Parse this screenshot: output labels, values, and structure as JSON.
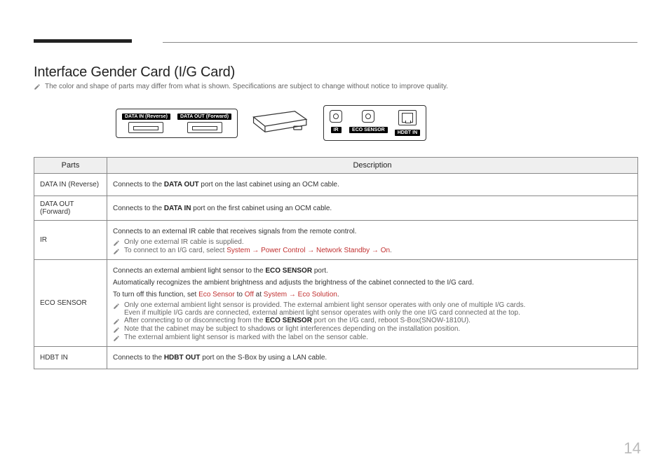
{
  "title": "Interface Gender Card (I/G Card)",
  "top_note": "The color and shape of parts may differ from what is shown. Specifications are subject to change without notice to improve quality.",
  "diagram": {
    "data_in_label": "DATA IN (Reverse)",
    "data_out_label": "DATA OUT (Forward)",
    "ir_label": "IR",
    "eco_label": "ECO SENSOR",
    "hdbt_label": "HDBT IN"
  },
  "table": {
    "header_parts": "Parts",
    "header_desc": "Description",
    "rows": {
      "data_in": {
        "part": "DATA IN (Reverse)",
        "desc_pre": "Connects to the ",
        "desc_bold": "DATA OUT",
        "desc_post": " port on the last cabinet using an OCM cable."
      },
      "data_out": {
        "part": "DATA OUT (Forward)",
        "desc_pre": "Connects to the ",
        "desc_bold": "DATA IN",
        "desc_post": " port on the first cabinet using an OCM cable."
      },
      "ir": {
        "part": "IR",
        "line1": "Connects to an external IR cable that receives signals from the remote control.",
        "note1": "Only one external IR cable is supplied.",
        "note2_pre": "To connect to an I/G card, select ",
        "note2_path": "System → Power Control → Network Standby → On",
        "note2_post": "."
      },
      "eco": {
        "part": "ECO SENSOR",
        "line1_pre": "Connects an external ambient light sensor to the ",
        "line1_bold": "ECO SENSOR",
        "line1_post": " port.",
        "line2": "Automatically recognizes the ambient brightness and adjusts the brightness of the cabinet connected to the I/G card.",
        "line3_pre": "To turn off this function, set ",
        "line3_p1": "Eco Sensor",
        "line3_mid1": " to ",
        "line3_p2": "Off",
        "line3_mid2": " at ",
        "line3_p3": "System → Eco Solution",
        "line3_post": ".",
        "note1a": "Only one external ambient light sensor is provided. The external ambient light sensor operates with only one of multiple I/G cards.",
        "note1b": "Even if multiple I/G cards are connected, external ambient light sensor operates with only the one I/G card connected at the top.",
        "note2_pre": "After connecting to or disconnecting from the ",
        "note2_bold": "ECO SENSOR",
        "note2_post": " port on the I/G card, reboot S-Box(SNOW-1810U).",
        "note3": "Note that the cabinet may be subject to shadows or light interferences depending on the installation position.",
        "note4": "The external ambient light sensor is marked with the label on the sensor cable."
      },
      "hdbt": {
        "part": "HDBT IN",
        "desc_pre": "Connects to the ",
        "desc_bold": "HDBT OUT",
        "desc_post": " port on the S-Box by using a LAN cable."
      }
    }
  },
  "page_number": "14"
}
